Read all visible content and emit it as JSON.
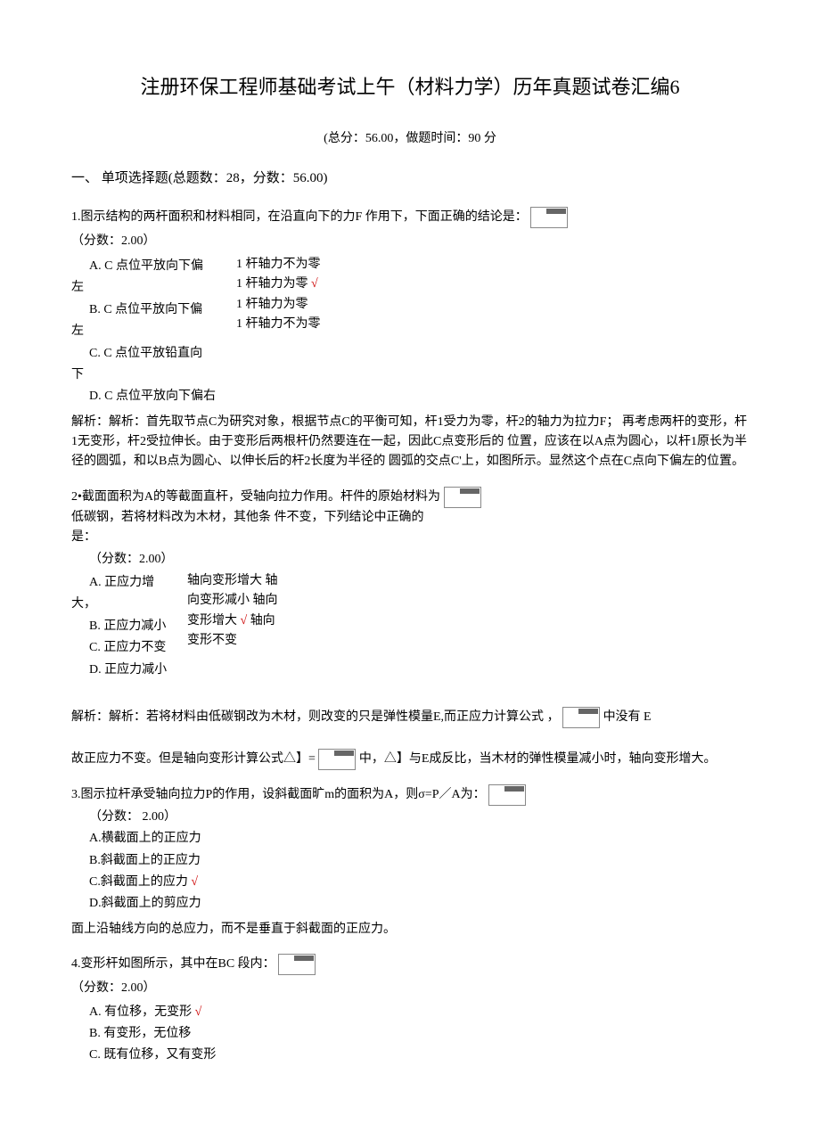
{
  "title": "注册环保工程师基础考试上午（材料力学）历年真题试卷汇编6",
  "meta": "(总分：56.00，做题时间：90 分",
  "section": "一、 单项选择题(总题数：28，分数：56.00)",
  "q1": {
    "text": "1.图示结构的两杆面积和材料相同，在沿直向下的力F 作用下，下面正确的结论是：",
    "score": "（分数：2.00）",
    "colL_A": "A. C 点位平放向下偏",
    "colL_AL": "左",
    "colL_B": "B. C 点位平放向下偏",
    "colL_BL": "左",
    "colL_C": "C. C 点位平放铅直向",
    "colL_CL": "下",
    "colR_1": "1 杆轴力不为零",
    "colR_2a": "1 杆轴力为零 ",
    "colR_2v": "√",
    "colR_3": "1 杆轴力为零",
    "colR_4": "1 杆轴力不为零",
    "optD": "D. C 点位平放向下偏右",
    "analysis": "解析：解析：首先取节点C为研究对象，根据节点C的平衡可知，杆1受力为零，杆2的轴力为拉力F； 再考虑两杆的变形，杆1无变形，杆2受拉伸长。由于变形后两根杆仍然要连在一起，因此C点变形后的 位置，应该在以A点为圆心，以杆1原长为半径的圆弧，和以B点为圆心、以伸长后的杆2长度为半径的 圆弧的交点C'上，如图所示。显然这个点在C点向下偏左的位置。"
  },
  "q2": {
    "l1": "2•截面面积为A的等截面直杆，受轴向拉力作用。杆件的原始材料为",
    "l2": "低碳钢，若将材料改为木材，其他条 件不变，下列结论中正确的",
    "l3": "是：",
    "score": "（分数：2.00）",
    "colL_A": "A. 正应力增",
    "colL_AL": "大，",
    "colL_B": "B. 正应力减小",
    "colL_C": "C. 正应力不变",
    "colL_D": "D. 正应力减小",
    "colR_A1": "轴向变形增大 轴",
    "colR_A2": "向变形减小 轴向",
    "colR_B": "变形增大 ",
    "colR_Bv": "√",
    "colR_B2": " 轴向",
    "colR_C": "变形不变",
    "a_p1a": "解析：解析：若将材料由低碳钢改为木材，则改变的只是弹性模量E,而正应力计算公式",
    "a_p1b": "，",
    "a_p1c": "中没有 E",
    "a_p2a": "故正应力不变。但是轴向变形计算公式△】=",
    "a_p2b": "中，△】与E成反比，当木材的弹性模量减小时，轴向变形增大。"
  },
  "q3": {
    "text": "3.图示拉杆承受轴向拉力P的作用，设斜截面旷m的面积为A，则σ=P／A为：",
    "score": "（分数： 2.00）",
    "optA": "A.横截面上的正应力",
    "optB": "B.斜截面上的正应力",
    "optCa": "C.斜截面上的应力 ",
    "optCv": "√",
    "optD": "D.斜截面上的剪应力",
    "analysis": "面上沿轴线方向的总应力，而不是垂直于斜截面的正应力。"
  },
  "q4": {
    "text": "4.变形杆如图所示，其中在BC 段内：",
    "score": "（分数：2.00）",
    "optAa": "A. 有位移，无变形 ",
    "optAv": "√",
    "optB": "B. 有变形，无位移",
    "optC": "C. 既有位移，又有变形"
  }
}
